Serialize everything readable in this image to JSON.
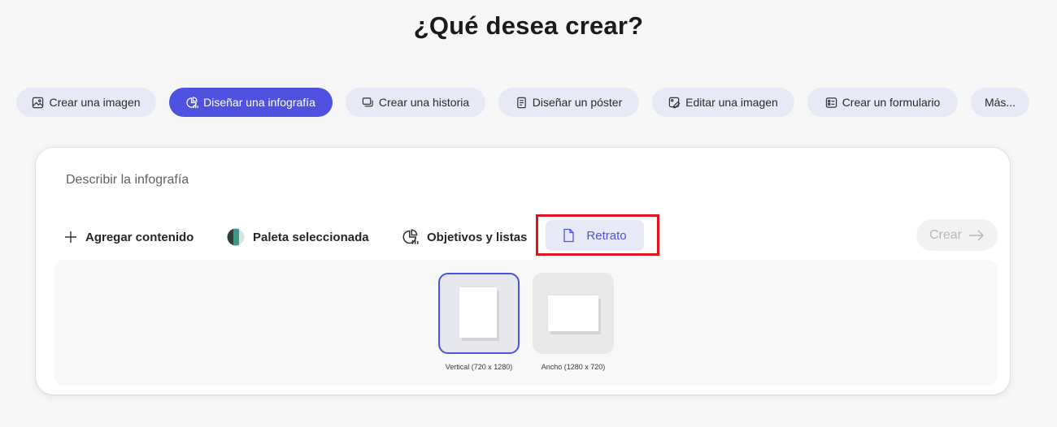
{
  "page": {
    "title": "¿Qué desea crear?"
  },
  "chips": [
    {
      "label": "Crear una imagen",
      "icon": "image-icon",
      "active": false
    },
    {
      "label": "Diseñar una infografía",
      "icon": "infographic-icon",
      "active": true
    },
    {
      "label": "Crear una historia",
      "icon": "story-icon",
      "active": false
    },
    {
      "label": "Diseñar un póster",
      "icon": "poster-icon",
      "active": false
    },
    {
      "label": "Editar una imagen",
      "icon": "edit-image-icon",
      "active": false
    },
    {
      "label": "Crear un formulario",
      "icon": "form-icon",
      "active": false
    },
    {
      "label": "Más...",
      "icon": "",
      "active": false
    }
  ],
  "composer": {
    "placeholder": "Describir la infografía",
    "add_content": "Agregar contenido",
    "palette": "Paleta seleccionada",
    "objectives": "Objetivos y listas",
    "orientation": "Retrato",
    "create": "Crear"
  },
  "orientations": [
    {
      "label": "Vertical (720 x 1280)",
      "selected": true
    },
    {
      "label": "Ancho (1280 x 720)",
      "selected": false
    }
  ],
  "colors": {
    "accent": "#4f52e0",
    "chip_bg": "#e8e9f6",
    "highlight": "#e0141e"
  }
}
